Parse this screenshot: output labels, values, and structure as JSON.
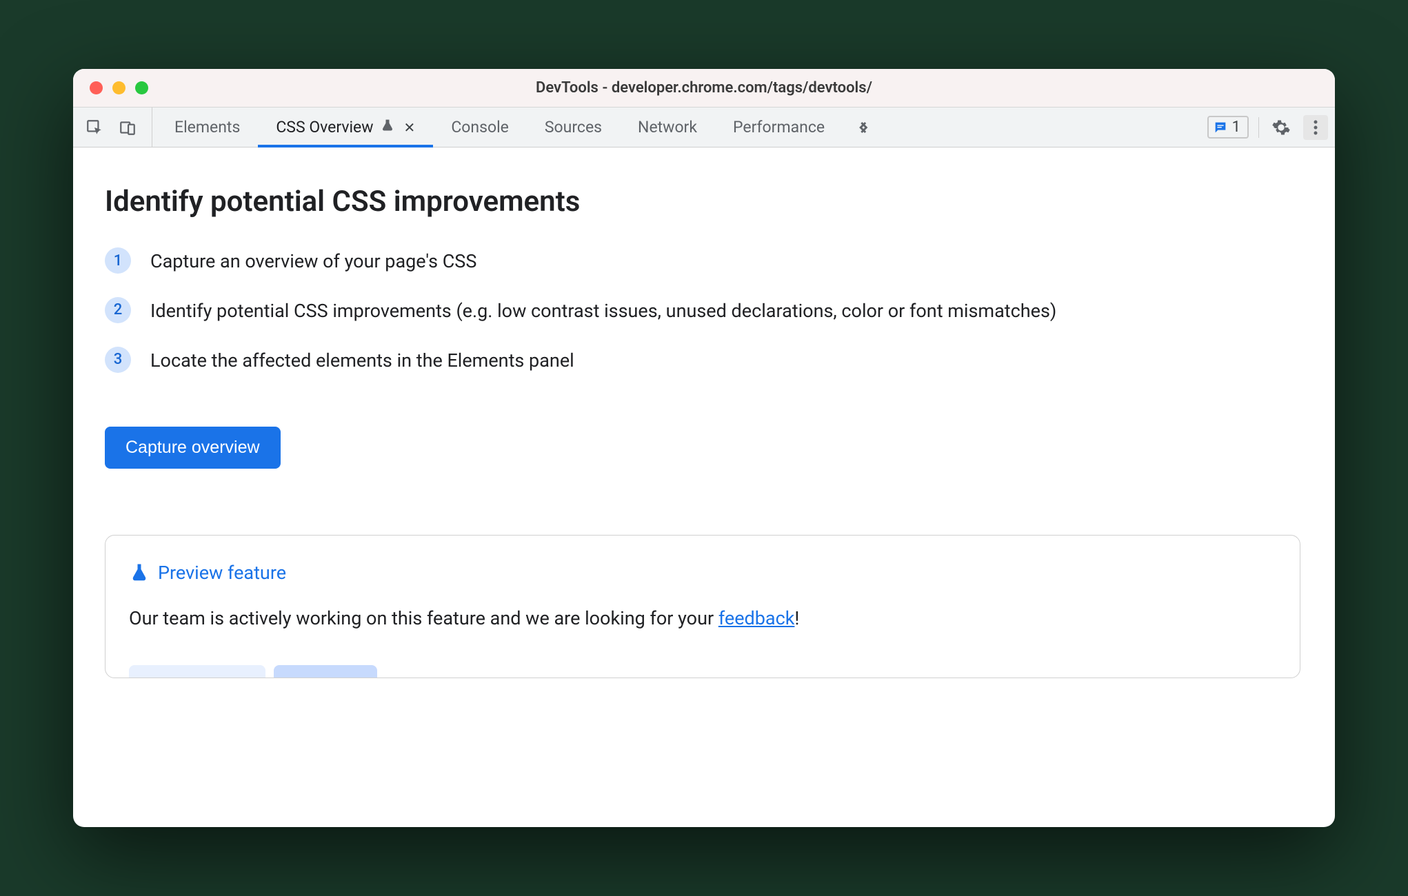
{
  "window": {
    "title": "DevTools - developer.chrome.com/tags/devtools/"
  },
  "tabs": {
    "items": [
      {
        "label": "Elements"
      },
      {
        "label": "CSS Overview"
      },
      {
        "label": "Console"
      },
      {
        "label": "Sources"
      },
      {
        "label": "Network"
      },
      {
        "label": "Performance"
      }
    ]
  },
  "issues": {
    "count": "1"
  },
  "main": {
    "heading": "Identify potential CSS improvements",
    "steps": [
      {
        "num": "1",
        "text": "Capture an overview of your page's CSS"
      },
      {
        "num": "2",
        "text": "Identify potential CSS improvements (e.g. low contrast issues, unused declarations, color or font mismatches)"
      },
      {
        "num": "3",
        "text": "Locate the affected elements in the Elements panel"
      }
    ],
    "capture_label": "Capture overview"
  },
  "preview": {
    "title": "Preview feature",
    "body_pre": "Our team is actively working on this feature and we are looking for your ",
    "link": "feedback",
    "body_post": "!"
  }
}
